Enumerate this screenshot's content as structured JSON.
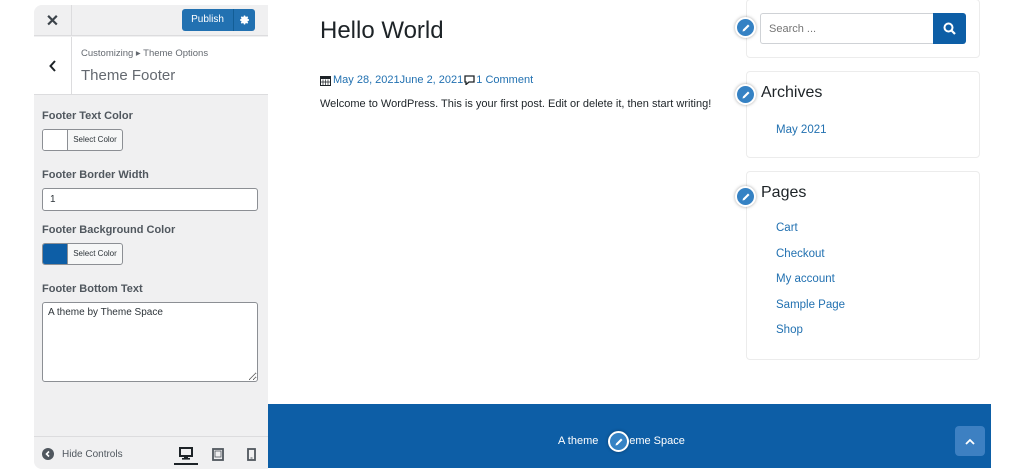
{
  "customizer": {
    "close_label": "✕",
    "publish_label": "Publish",
    "breadcrumb": "Customizing ▸ Theme Options",
    "section_title": "Theme Footer",
    "controls": {
      "footer_text_color": {
        "label": "Footer Text Color",
        "button_label": "Select Color",
        "value": "#ffffff"
      },
      "footer_border_width": {
        "label": "Footer Border Width",
        "value": "1"
      },
      "footer_background_color": {
        "label": "Footer Background Color",
        "button_label": "Select Color",
        "value": "#0d5ea6"
      },
      "footer_bottom_text": {
        "label": "Footer Bottom Text",
        "value": "A theme by Theme Space"
      }
    },
    "footer": {
      "hide_controls_label": "Hide Controls",
      "active_device": "desktop"
    }
  },
  "preview": {
    "post": {
      "title": "Hello World",
      "date_published": "May 28, 2021",
      "date_updated": "June 2, 2021",
      "comments": "1 Comment",
      "body": "Welcome to WordPress. This is your first post. Edit or delete it, then start writing!"
    },
    "search": {
      "placeholder": "Search ..."
    },
    "archives": {
      "title": "Archives",
      "items": [
        "May 2021"
      ]
    },
    "pages": {
      "title": "Pages",
      "items": [
        "Cart",
        "Checkout",
        "My account",
        "Sample Page",
        "Shop"
      ]
    },
    "site_footer": {
      "text_before": "A theme",
      "text_after": "Theme Space"
    }
  },
  "colors": {
    "accent": "#2271b1",
    "footer_bg": "#0d5ea6",
    "edit_shortcut": "#3582c4",
    "scroll_top": "#3d80c2"
  }
}
